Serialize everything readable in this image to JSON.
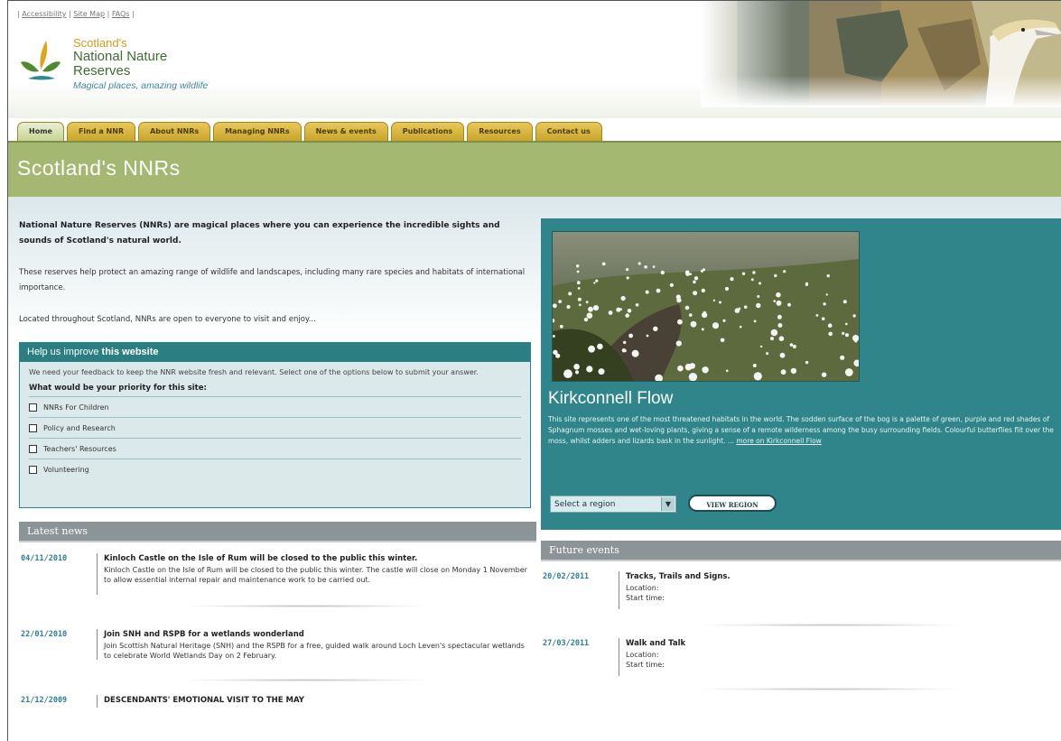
{
  "toplinks": {
    "accessibility": "Accessibility",
    "sitemap": "Site Map",
    "faqs": "FAQs",
    "sep": " | "
  },
  "logo": {
    "line1": "Scotland's",
    "line2": "National Nature",
    "line3": "Reserves",
    "tagline": "Magical places, amazing wildlife"
  },
  "tabs": [
    "Home",
    "Find a NNR",
    "About NNRs",
    "Managing NNRs",
    "News & events",
    "Publications",
    "Resources",
    "Contact us"
  ],
  "page_title": "Scotland's NNRs",
  "intro": {
    "lead": "National Nature Reserves (NNRs) are magical places where you can experience the incredible sights and sounds of Scotland's natural world.",
    "p1": "These reserves help protect an amazing range of wildlife and landscapes, including many rare species and habitats of international importance.",
    "p2": "Located throughout Scotland, NNRs are open to everyone to visit and enjoy..."
  },
  "feedback": {
    "title_pre": "Help us improve ",
    "title_bold": "this website",
    "desc": "We need your feedback to keep the NNR website fresh and relevant. Select one of the options below to submit your answer.",
    "question": "What would be your priority for this site:",
    "options": [
      "NNRs For Children",
      "Policy and Research",
      "Teachers' Resources",
      "Volunteering"
    ]
  },
  "latest_news": {
    "heading": "Latest news",
    "items": [
      {
        "date": "04/11/2010",
        "title": "Kinloch Castle on the Isle of Rum will be closed to the public this winter.",
        "body": "Kinloch Castle on the Isle of Rum will be closed to the public this winter. The castle will close on Monday 1 November to allow essential internal repair and maintenance work to be carried out."
      },
      {
        "date": "22/01/2010",
        "title": "Join SNH and RSPB for a wetlands wonderland",
        "body": "Join Scottish Natural Heritage (SNH) and the RSPB for a free, guided walk around Loch Leven's spectacular wetlands to celebrate World Wetlands Day on 2 February."
      },
      {
        "date": "21/12/2009",
        "title": "DESCENDANTS' EMOTIONAL VISIT TO THE MAY",
        "body": ""
      }
    ]
  },
  "feature": {
    "title": "Kirkconnell Flow",
    "desc": "This site represents one of the most threatened habitats in the world. The sodden surface of the bog is a palette of green, purple and red shades of Sphagnum mosses and wet-loving plants, giving a sense of a remote wilderness among the busy surrounding fields. Colourful butterflies flit over the moss, whilst adders and lizards bask in the sunlight. ...",
    "more_link": "more on Kirkconnell Flow",
    "region_select": "Select a region",
    "view_button": "VIEW REGION"
  },
  "future_events": {
    "heading": "Future events",
    "items": [
      {
        "date": "20/02/2011",
        "title": "Tracks, Trails and Signs.",
        "location_label": "Location:",
        "start_label": "Start time:"
      },
      {
        "date": "27/03/2011",
        "title": "Walk and Talk",
        "location_label": "Location:",
        "start_label": "Start time:"
      }
    ]
  },
  "colors": {
    "teal": "#2f8589",
    "olive": "#a4b871",
    "gold_tab": "#d4b03c",
    "grey_bar": "#8c9497"
  }
}
